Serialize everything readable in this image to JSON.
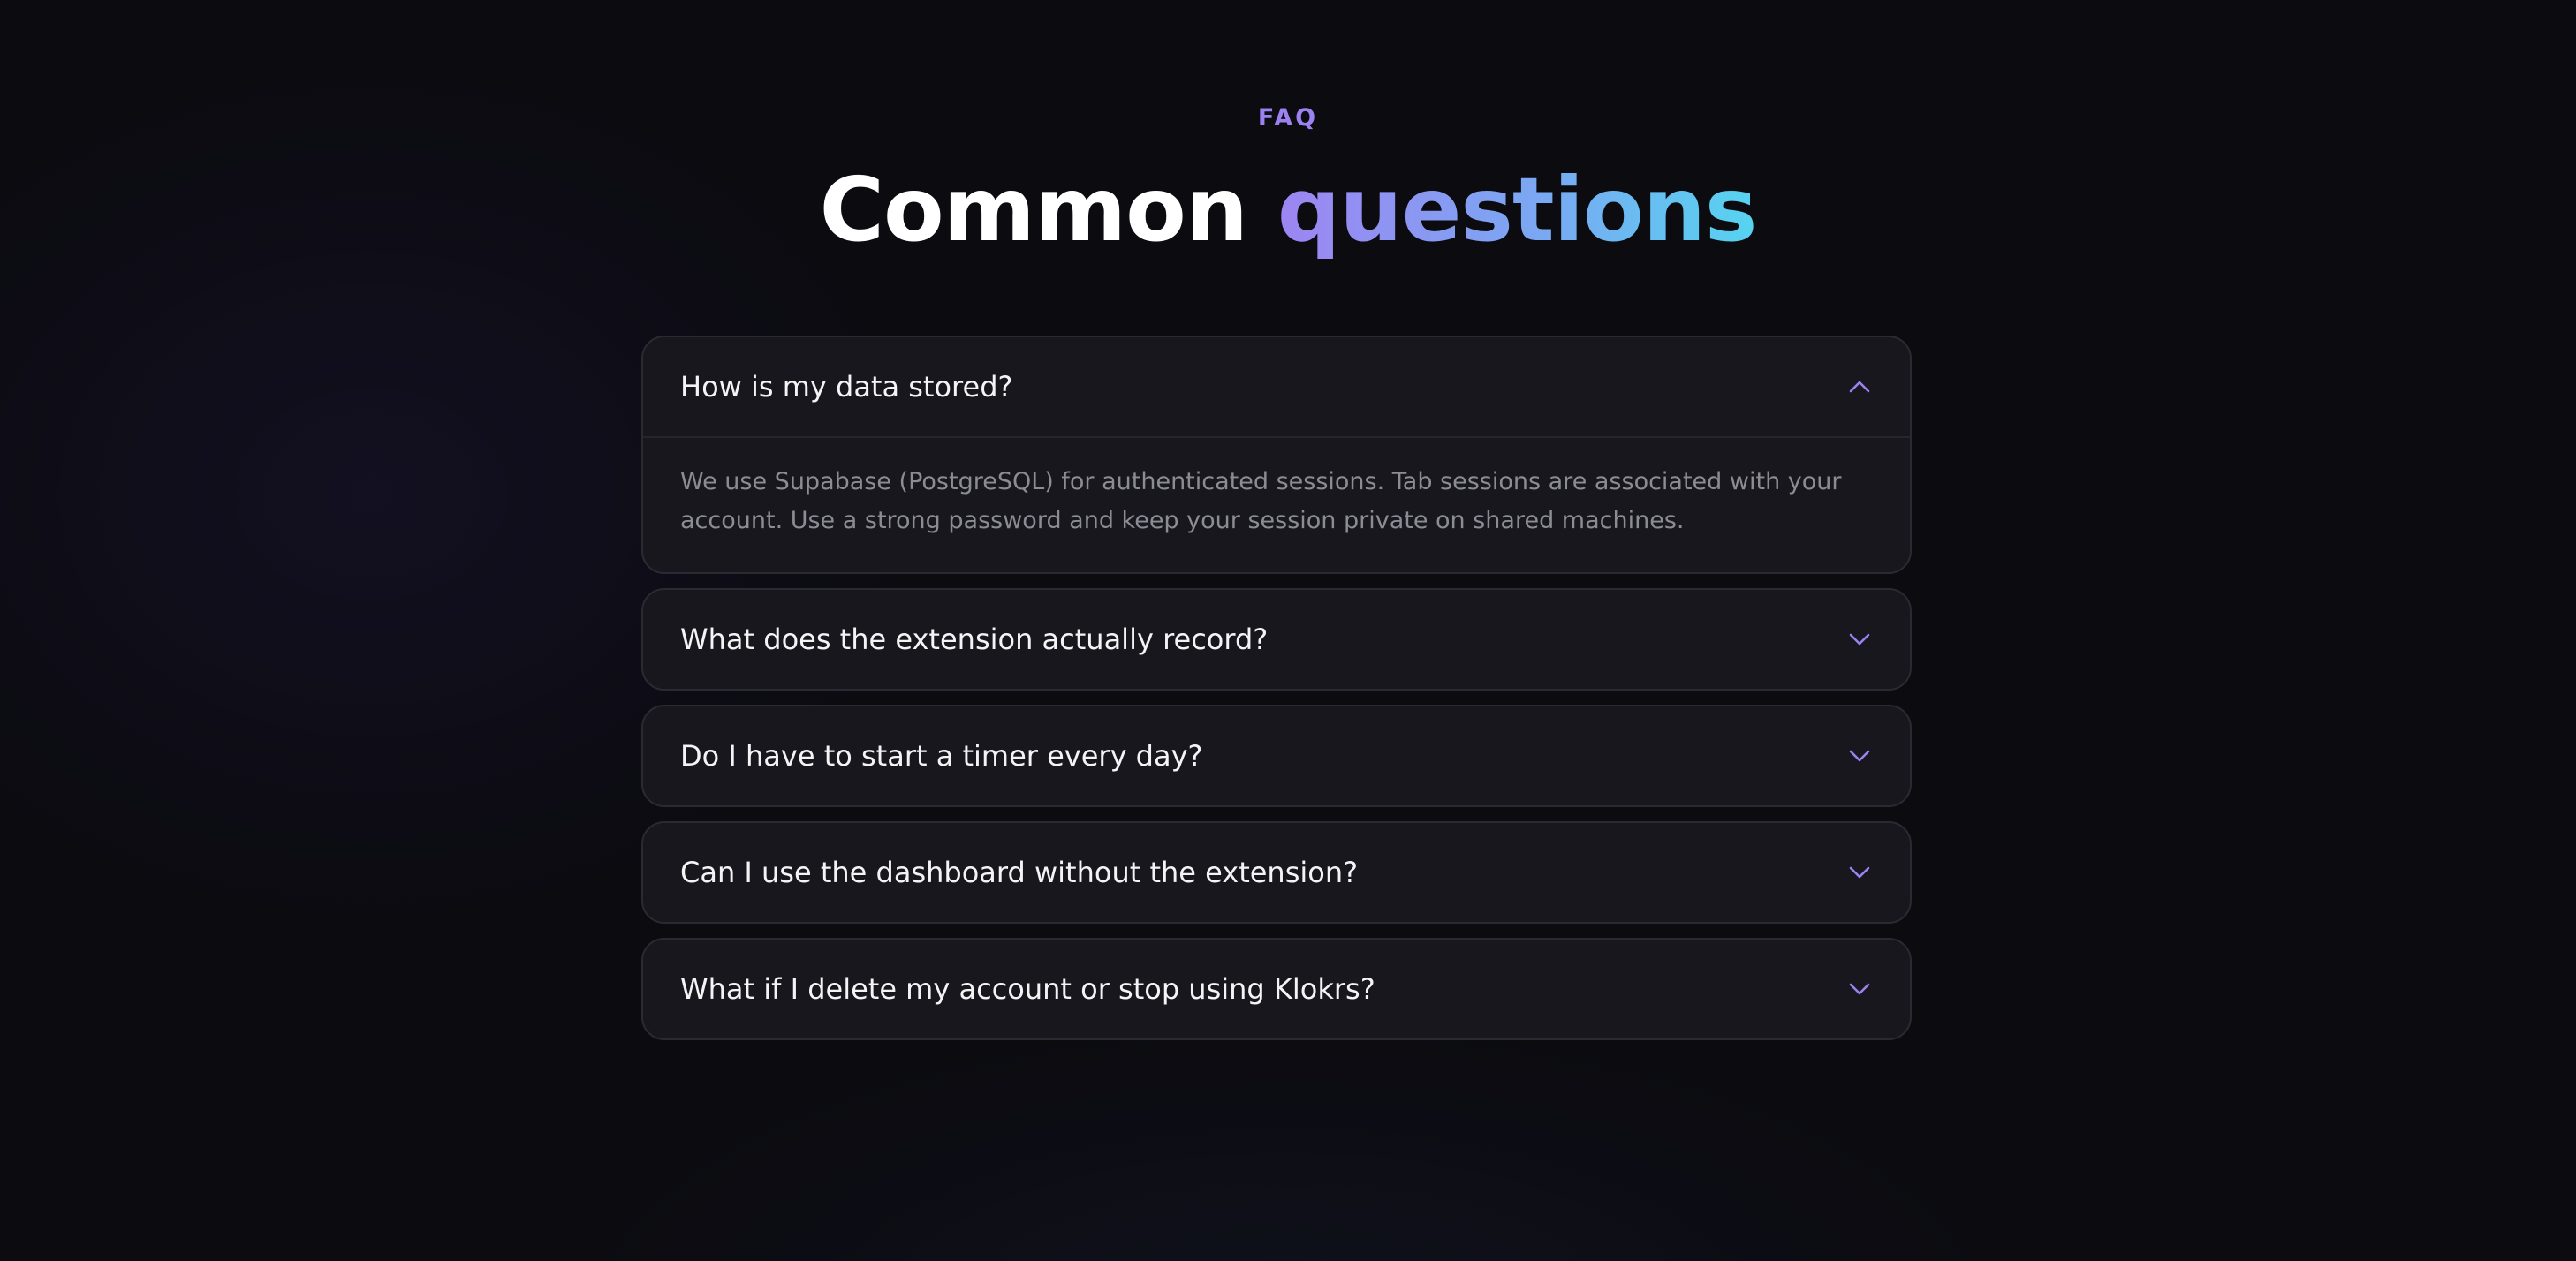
{
  "section": {
    "eyebrow": "FAQ",
    "heading_plain": "Common",
    "heading_accent": "questions"
  },
  "colors": {
    "accent": "#9b82f0",
    "gradient_start": "#9d85f2",
    "gradient_end": "#56d4f0",
    "background": "#0b0b10",
    "card": "#17171d"
  },
  "faq": {
    "items": [
      {
        "question": "How is my data stored?",
        "expanded": true,
        "icon": "chevron-up-icon",
        "answer": "We use Supabase (PostgreSQL) for authenticated sessions. Tab sessions are associated with your account. Use a strong password and keep your session private on shared machines."
      },
      {
        "question": "What does the extension actually record?",
        "expanded": false,
        "icon": "chevron-down-icon"
      },
      {
        "question": "Do I have to start a timer every day?",
        "expanded": false,
        "icon": "chevron-down-icon"
      },
      {
        "question": "Can I use the dashboard without the extension?",
        "expanded": false,
        "icon": "chevron-down-icon"
      },
      {
        "question": "What if I delete my account or stop using Klokrs?",
        "expanded": false,
        "icon": "chevron-down-icon"
      }
    ]
  }
}
